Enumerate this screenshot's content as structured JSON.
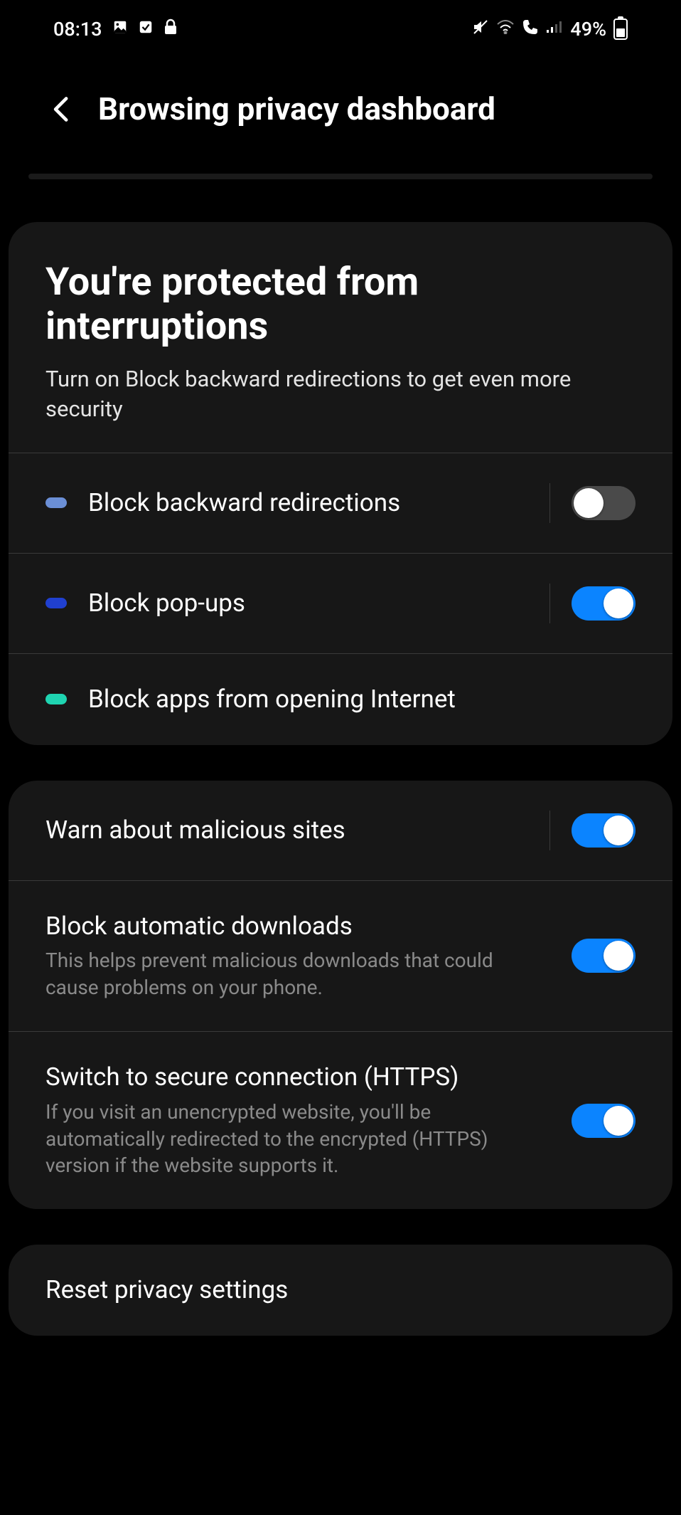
{
  "status": {
    "time": "08:13",
    "battery": "49%"
  },
  "page": {
    "title": "Browsing privacy dashboard"
  },
  "card1": {
    "title": "You're protected from interruptions",
    "subtitle": "Turn on Block backward redirections to get even more security",
    "items": [
      {
        "label": "Block backward redirections"
      },
      {
        "label": "Block pop-ups"
      },
      {
        "label": "Block apps from opening Internet"
      }
    ]
  },
  "card2": {
    "items": [
      {
        "label": "Warn about malicious sites"
      },
      {
        "label": "Block automatic downloads",
        "desc": "This helps prevent malicious downloads that could cause problems on your phone."
      },
      {
        "label": "Switch to secure connection (HTTPS)",
        "desc": "If you visit an unencrypted website, you'll be automatically redirected to the encrypted (HTTPS) version if the website supports it."
      }
    ]
  },
  "reset": {
    "label": "Reset privacy settings"
  }
}
